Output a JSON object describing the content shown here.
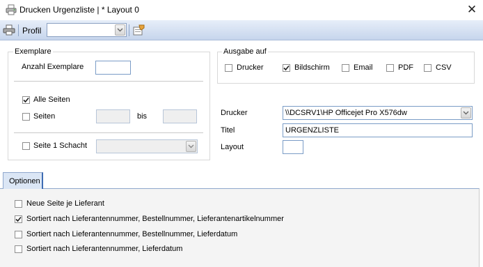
{
  "window": {
    "title": "Drucken Urgenzliste | * Layout 0",
    "close_symbol": "✕"
  },
  "toolbar": {
    "profil_label": "Profil",
    "profil_value": "",
    "printer_icon": "printer-icon",
    "settings_icon": "settings-icon"
  },
  "exemplare": {
    "group_label": "Exemplare",
    "anzahl_label": "Anzahl Exemplare",
    "anzahl_value": "",
    "alle_seiten_label": "Alle Seiten",
    "alle_seiten_checked": true,
    "seiten_label": "Seiten",
    "seiten_checked": false,
    "seiten_from": "",
    "bis_label": "bis",
    "seiten_to": "",
    "schacht_label": "Seite 1 Schacht",
    "schacht_checked": false,
    "schacht_value": ""
  },
  "ausgabe": {
    "group_label": "Ausgabe auf",
    "options": [
      {
        "label": "Drucker",
        "checked": false
      },
      {
        "label": "Bildschirm",
        "checked": true
      },
      {
        "label": "Email",
        "checked": false
      },
      {
        "label": "PDF",
        "checked": false
      },
      {
        "label": "CSV",
        "checked": false
      }
    ]
  },
  "settings": {
    "drucker_label": "Drucker",
    "drucker_value": "\\\\DCSRV1\\HP Officejet Pro X576dw",
    "titel_label": "Titel",
    "titel_value": "URGENZLISTE",
    "layout_label": "Layout",
    "layout_value": ""
  },
  "tabs": [
    {
      "label": "Optionen",
      "active": true
    }
  ],
  "optionen": [
    {
      "label": "Neue Seite je Lieferant",
      "checked": false
    },
    {
      "label": "Sortiert nach Lieferantennummer, Bestellnummer, Lieferantenartikelnummer",
      "checked": true
    },
    {
      "label": "Sortiert nach Lieferantennummer, Bestellnummer, Lieferdatum",
      "checked": false
    },
    {
      "label": "Sortiert nach Lieferantennummer, Lieferdatum",
      "checked": false
    }
  ],
  "colors": {
    "toolbar_gradient_top": "#e7eef9",
    "toolbar_gradient_bottom": "#c6d5ec",
    "field_border": "#7a9cc6",
    "tab_accent": "#3e6cb3",
    "panel_bg": "#f4f4f4"
  }
}
